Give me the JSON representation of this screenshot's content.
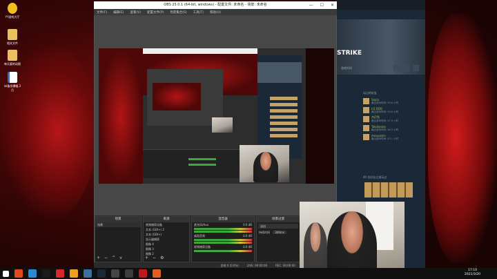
{
  "desktop": {
    "icons": [
      {
        "label": "YY游戏大厅",
        "color": "#f0c020"
      },
      {
        "label": "相关文件",
        "color": "#e8c060"
      },
      {
        "label": "每天要的动图",
        "color": "#e8c060"
      },
      {
        "label": "lol备份横幅\n2月",
        "color": "#ffffff"
      }
    ]
  },
  "steam": {
    "game_title": "STRIKE",
    "section_label": "游戏时间",
    "friends_header": "玩过的好友",
    "friends": [
      {
        "name": "Sayla",
        "sub": "最近游戏时间: 90.6 小时"
      },
      {
        "name": "LQ.DDQ",
        "sub": "最近游戏时间: 90.6 小时"
      },
      {
        "name": "杰尼龟",
        "sub": "最近游戏时间: 47.9 小时"
      },
      {
        "name": "Takokoooo",
        "sub": "最近游戏时间: 46.3 小时"
      },
      {
        "name": "missaosiin",
        "sub": "最近游戏时间: 43.1 小时"
      }
    ],
    "friends_more": "40 位好友之前玩过"
  },
  "obs": {
    "title": "OBS 25.0.1 (64-bit, windows) - 配置文件: 未命名 - 场景: 未命名",
    "menu": [
      "文件(F)",
      "编辑(E)",
      "查看(V)",
      "配置文件(P)",
      "场景集合(S)",
      "工具(T)",
      "帮助(H)"
    ],
    "docks": {
      "scenes": {
        "title": "场景",
        "items": [
          "场景"
        ]
      },
      "sources": {
        "title": "来源",
        "items": [
          "视频捕获设备",
          "文本 (GDI+) 2",
          "文本 (GDI+)",
          "显示器捕获",
          "图像 4",
          "图像 3",
          "图像 2"
        ]
      },
      "mixer": {
        "title": "混音器",
        "channels": [
          {
            "name": "麦克风/Aux",
            "db": "0.0 dB"
          },
          {
            "name": "桌面音频",
            "db": "0.0 dB"
          },
          {
            "name": "视频捕获设备",
            "db": "0.0 dB"
          }
        ]
      },
      "transitions": {
        "title": "场景过渡",
        "fade": "淡出",
        "duration_label": "持续时间",
        "duration": "300ms"
      },
      "controls": {
        "title": "控件"
      }
    },
    "status": {
      "dropped": "丢帧 0 (0.0%)",
      "live": "LIVE: 00:00:00",
      "rec": "REC: 00:00:00",
      "cpu": "CPU: 1.9%, 60.00 fps"
    }
  },
  "taskbar": {
    "time": "17:10",
    "date": "2021/3/20",
    "icon_colors": [
      "#e04a1a",
      "#2b8ad6",
      "#1a1a1a",
      "#d62828",
      "#f0a020",
      "#3c6e9e",
      "#1b2838",
      "#444444",
      "#3c3c3c",
      "#c01818",
      "#e06020"
    ]
  }
}
